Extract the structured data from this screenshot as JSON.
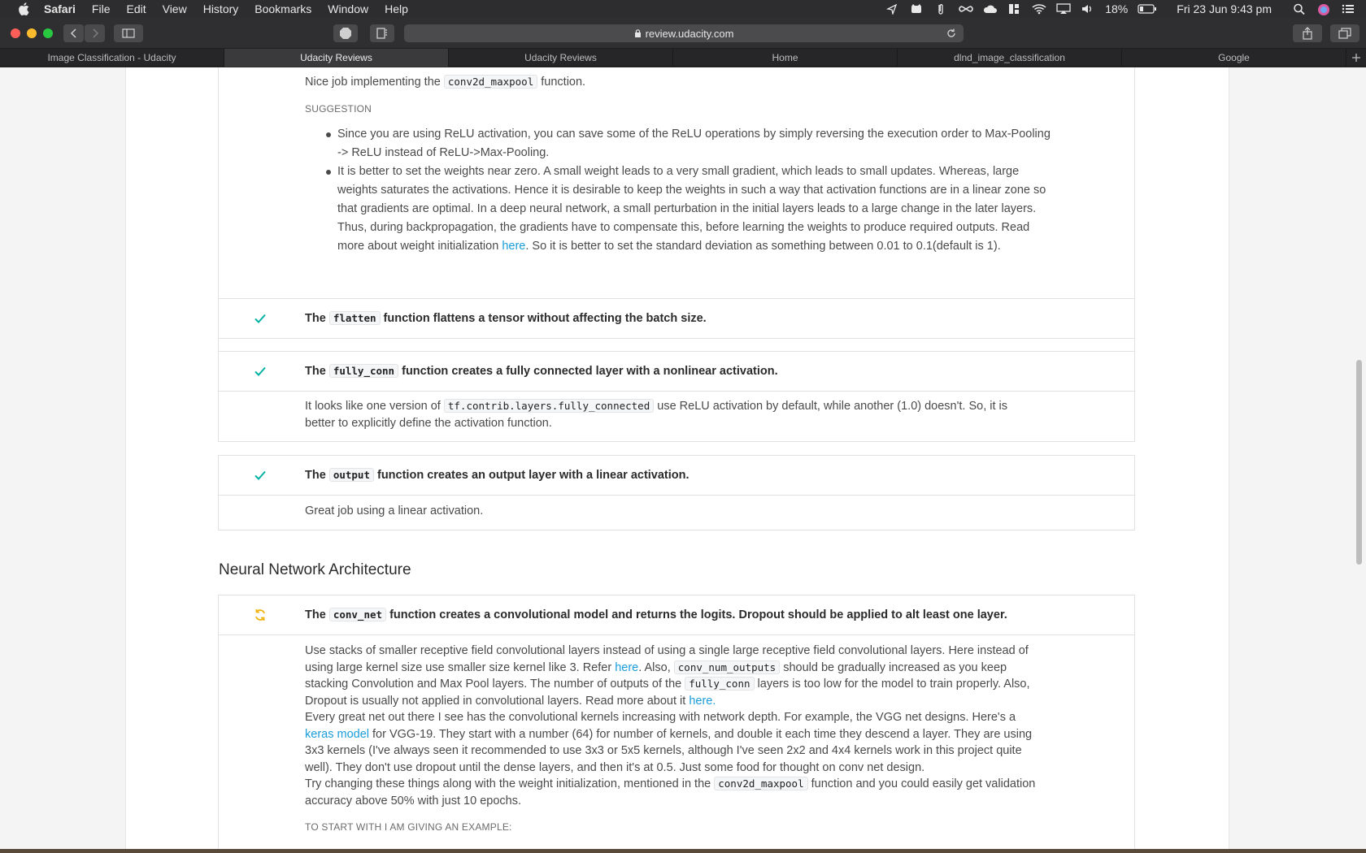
{
  "menubar": {
    "app": "Safari",
    "items": [
      "File",
      "Edit",
      "View",
      "History",
      "Bookmarks",
      "Window",
      "Help"
    ],
    "battery": "18%",
    "clock": "Fri 23 Jun  9:43 pm"
  },
  "toolbar": {
    "url": "review.udacity.com"
  },
  "tabs": [
    {
      "label": "Image Classification - Udacity",
      "active": false
    },
    {
      "label": "Udacity Reviews",
      "active": true
    },
    {
      "label": "Udacity Reviews",
      "active": false
    },
    {
      "label": "Home",
      "active": false
    },
    {
      "label": "dlnd_image_classification",
      "active": false
    },
    {
      "label": "Google",
      "active": false
    }
  ],
  "review": {
    "conv2d_box": {
      "nice_pre": "Nice job implementing the",
      "nice_code": "conv2d_maxpool",
      "nice_post": "function.",
      "suggestion_label": "SUGGESTION",
      "bullet1": "Since you are using ReLU activation, you can save some of the ReLU operations by simply reversing the execution order to Max-Pooling -> ReLU instead of ReLU->Max-Pooling.",
      "bullet2_pre": "It is better to set the weights near zero. A small weight leads to a very small gradient, which leads to small updates. Whereas, large weights saturates the activations. Hence it is desirable to keep the weights in such a way that activation functions are in a linear zone so that gradients are optimal. In a deep neural network, a small perturbation in the initial layers leads to a large change in the later layers. Thus, during backpropagation, the gradients have to compensate this, before learning the weights to produce required outputs. Read more about weight initialization",
      "bullet2_link": "here",
      "bullet2_post": ". So it is better to set the standard deviation as something between 0.01 to 0.1(default is 1)."
    },
    "flatten": {
      "pre": "The",
      "code": "flatten",
      "post": "function flattens a tensor without affecting the batch size."
    },
    "fully_conn": {
      "pre": "The",
      "code": "fully_conn",
      "post": "function creates a fully connected layer with a nonlinear activation.",
      "body_pre": "It looks like one version of",
      "body_code": "tf.contrib.layers.fully_connected",
      "body_post": "use ReLU activation by default, while another (1.0) doesn't. So, it is better to explicitly define the activation function."
    },
    "output": {
      "pre": "The",
      "code": "output",
      "post": "function creates an output layer with a linear activation.",
      "body": "Great job using a linear activation."
    },
    "section_title": "Neural Network Architecture",
    "conv_net": {
      "pre": "The",
      "code": "conv_net",
      "post": "function creates a convolutional model and returns the logits. Dropout should be applied to alt least one layer.",
      "p1_a": "Use stacks of smaller receptive field convolutional layers instead of using a single large receptive field convolutional layers. Here instead of using large kernel size use smaller size kernel like 3. Refer",
      "p1_link1": "here",
      "p1_b": ". Also,",
      "p1_code1": "conv_num_outputs",
      "p1_c": "should be gradually increased as you keep stacking Convolution and Max Pool layers. The number of outputs of the",
      "p1_code2": "fully_conn",
      "p1_d": "layers is too low for the model to train properly. Also, Dropout is usually not applied in convolutional layers. Read more about it",
      "p1_link2": "here.",
      "p2_a": "Every great net out there I see has the convolutional kernels increasing with network depth. For example, the VGG net designs. Here's a",
      "p2_link": "keras model",
      "p2_b": "for VGG-19. They start with a number (64) for number of kernels, and double it each time they descend a layer. They are using 3x3 kernels (I've always seen it recommended to use 3x3 or 5x5 kernels, although I've seen 2x2 and 4x4 kernels work in this project quite well). They don't use dropout until the dense layers, and then it's at 0.5. Just some food for thought on conv net design.",
      "p3_a": "Try changing these things along with the weight initialization, mentioned in the",
      "p3_code": "conv2d_maxpool",
      "p3_b": "function and you could easily get validation accuracy above 50% with just 10 epochs.",
      "example_label": "TO START WITH I AM GIVING AN EXAMPLE:"
    }
  },
  "colors": {
    "check": "#02b3a4",
    "warn": "#f0b30f",
    "link": "#1a9dd9"
  }
}
